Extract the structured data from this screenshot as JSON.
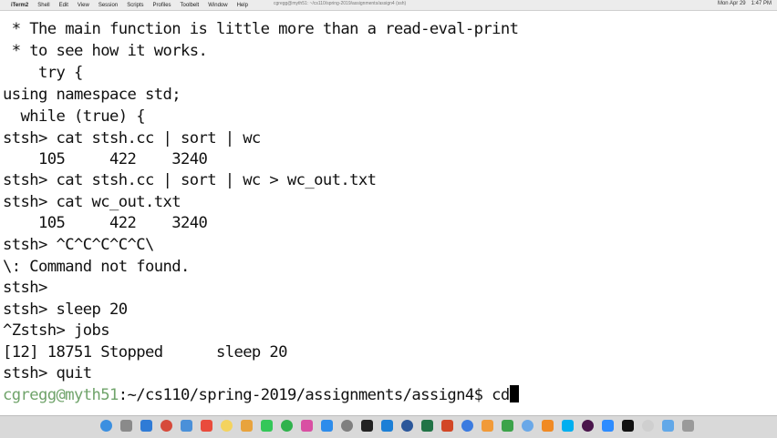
{
  "menubar": {
    "apple_glyph": "",
    "items": [
      "iTerm2",
      "Shell",
      "Edit",
      "View",
      "Session",
      "Scripts",
      "Profiles",
      "Toolbelt",
      "Window",
      "Help"
    ],
    "window_title": "cgregg@myth51: ~/cs110/spring-2019/assignments/assign4 (ssh)",
    "status_right": [
      "Mon Apr 29",
      "1:47 PM"
    ]
  },
  "terminal": {
    "lines": [
      " * The main function is little more than a read-eval-print",
      " * to see how it works.",
      "    try {",
      "using namespace std;",
      "  while (true) {",
      "stsh> cat stsh.cc | sort | wc",
      "    105     422    3240",
      "stsh> cat stsh.cc | sort | wc > wc_out.txt",
      "stsh> cat wc_out.txt",
      "    105     422    3240",
      "stsh> ^C^C^C^C^C\\",
      "\\: Command not found.",
      "stsh>",
      "stsh> sleep 20",
      "^Zstsh> jobs",
      "[12] 18751 Stopped      sleep 20",
      "stsh> quit"
    ],
    "prompt_user": "cgregg@myth51",
    "prompt_path": ":~/cs110/spring-2019/assignments/assign4$ ",
    "prompt_input": "cd"
  },
  "dock": {
    "icons": [
      {
        "name": "finder",
        "color": "#3b8fe0"
      },
      {
        "name": "launchpad",
        "color": "#8a8a8a"
      },
      {
        "name": "safari",
        "color": "#2f7bd6"
      },
      {
        "name": "chrome",
        "color": "#d64a3b"
      },
      {
        "name": "mail",
        "color": "#4a90d9"
      },
      {
        "name": "calendar",
        "color": "#e94b3c"
      },
      {
        "name": "notes",
        "color": "#f4d35e"
      },
      {
        "name": "photos",
        "color": "#e8a33d"
      },
      {
        "name": "messages",
        "color": "#34c759"
      },
      {
        "name": "facetime",
        "color": "#2fb24c"
      },
      {
        "name": "itunes",
        "color": "#d94fa3"
      },
      {
        "name": "app-store",
        "color": "#2d8ceb"
      },
      {
        "name": "system-preferences",
        "color": "#7f7f7f"
      },
      {
        "name": "terminal",
        "color": "#222222"
      },
      {
        "name": "xcode",
        "color": "#1c7fd6"
      },
      {
        "name": "word",
        "color": "#2b579a"
      },
      {
        "name": "excel",
        "color": "#217346"
      },
      {
        "name": "powerpoint",
        "color": "#d24726"
      },
      {
        "name": "keynote",
        "color": "#3b7be0"
      },
      {
        "name": "pages",
        "color": "#f19a38"
      },
      {
        "name": "numbers",
        "color": "#3ca34a"
      },
      {
        "name": "preview",
        "color": "#6aa8e8"
      },
      {
        "name": "vlc",
        "color": "#f08a24"
      },
      {
        "name": "skype",
        "color": "#00aff0"
      },
      {
        "name": "slack",
        "color": "#4a154b"
      },
      {
        "name": "zoom",
        "color": "#2d8cff"
      },
      {
        "name": "iterm",
        "color": "#111111"
      },
      {
        "name": "textedit",
        "color": "#cfcfcf"
      },
      {
        "name": "folder",
        "color": "#62a8e8"
      },
      {
        "name": "trash",
        "color": "#9a9a9a"
      }
    ]
  }
}
